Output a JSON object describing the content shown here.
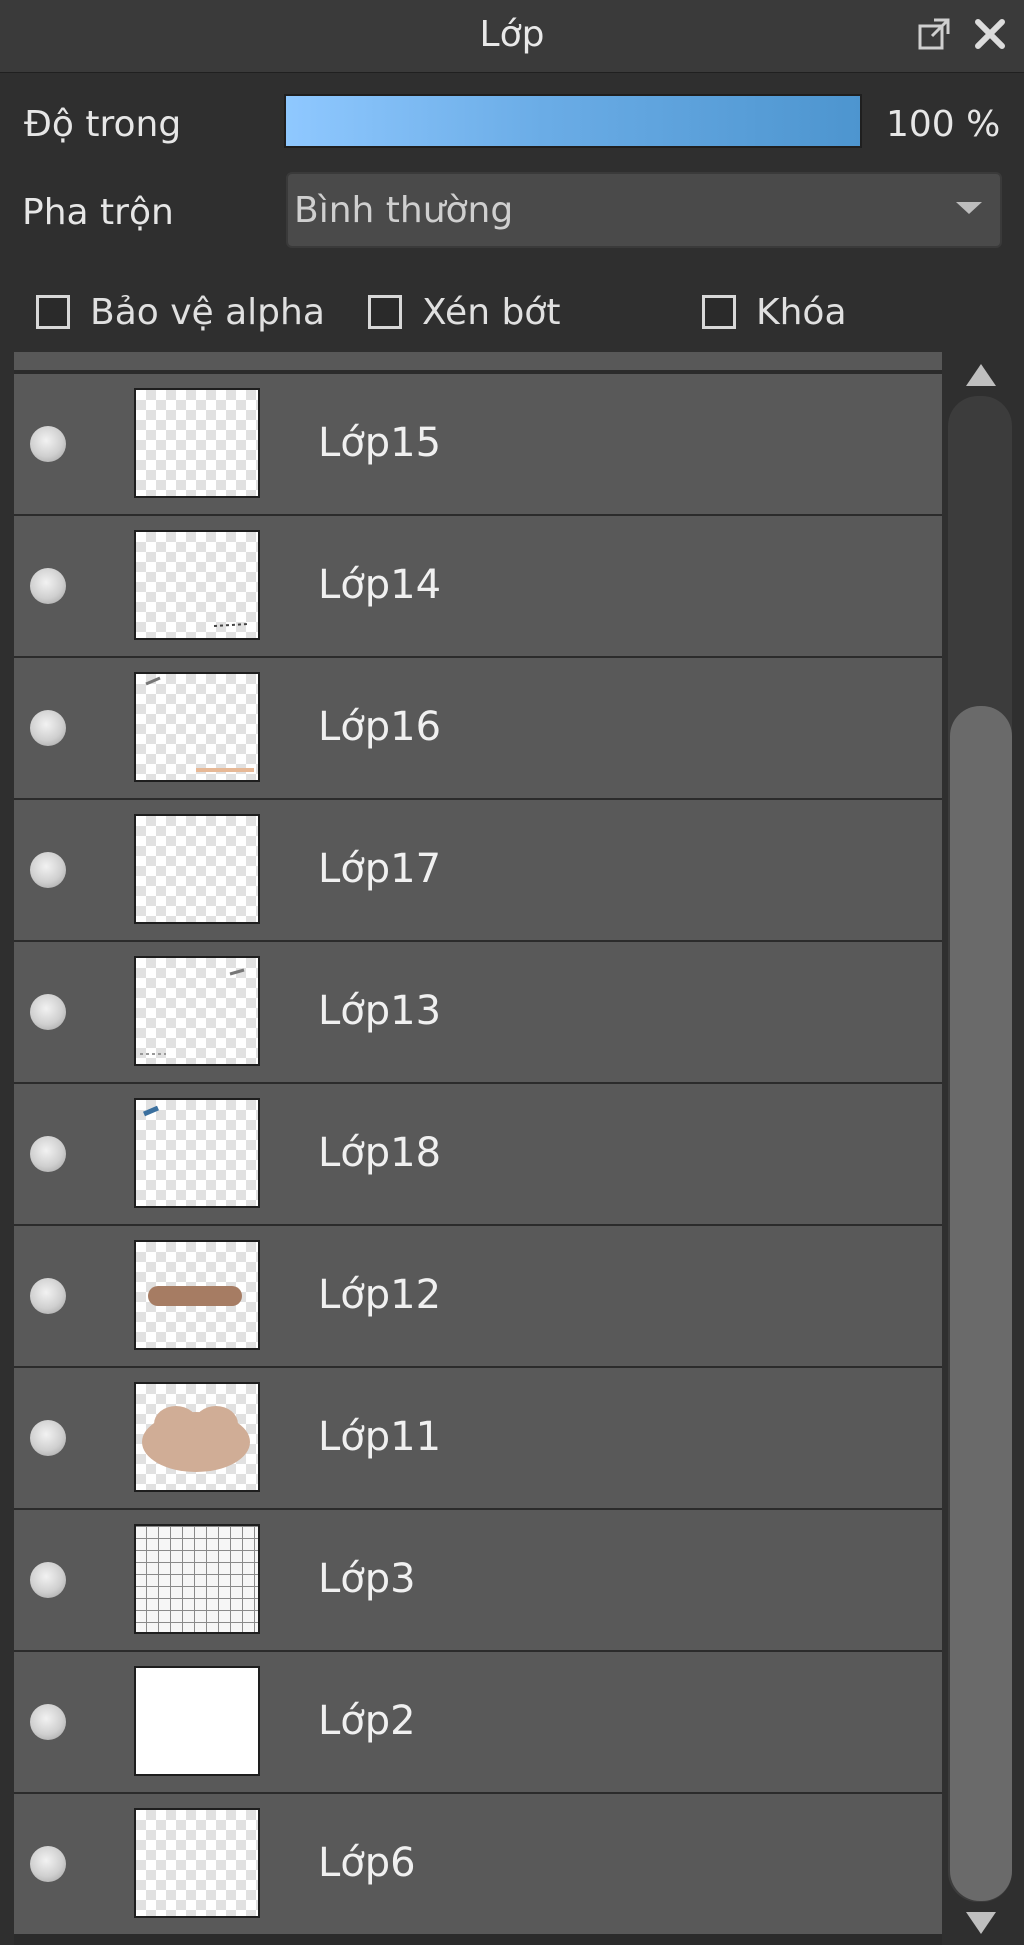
{
  "panel": {
    "title": "Lớp"
  },
  "opacity": {
    "label": "Độ trong",
    "value": "100 %",
    "level_percent": 100
  },
  "blend": {
    "label": "Pha trộn",
    "value": "Bình thường"
  },
  "checkboxes": [
    {
      "label": "Bảo vệ alpha",
      "checked": false
    },
    {
      "label": "Xén bớt",
      "checked": false
    },
    {
      "label": "Khóa",
      "checked": false
    }
  ],
  "layers": [
    {
      "name": "Lớp15"
    },
    {
      "name": "Lớp14"
    },
    {
      "name": "Lớp16"
    },
    {
      "name": "Lớp17"
    },
    {
      "name": "Lớp13"
    },
    {
      "name": "Lớp18"
    },
    {
      "name": "Lớp12"
    },
    {
      "name": "Lớp11"
    },
    {
      "name": "Lớp3"
    },
    {
      "name": "Lớp2"
    },
    {
      "name": "Lớp6"
    }
  ],
  "colors": {
    "accent": "#6aace6",
    "row_bg": "#595959",
    "panel_bg": "#2f2f2f"
  }
}
